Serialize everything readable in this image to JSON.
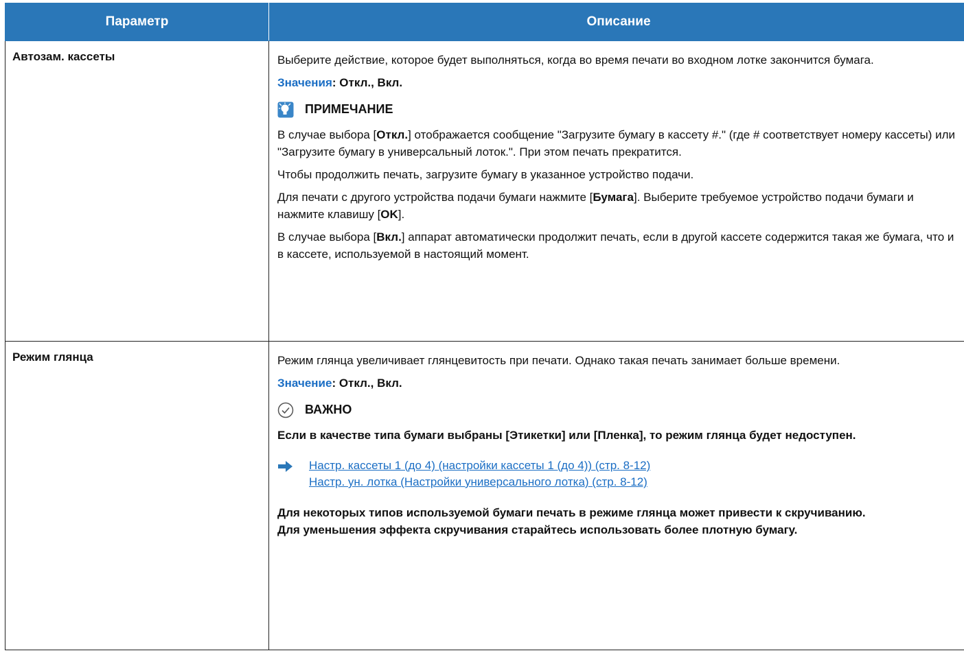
{
  "header": {
    "col_param": "Параметр",
    "col_desc": "Описание"
  },
  "rows": [
    {
      "param": "Автозам. кассеты",
      "intro": "Выберите действие, которое будет выполняться, когда во время печати во входном лотке закончится бумага.",
      "values_label": "Значения",
      "values_text": ": Откл., Вкл.",
      "note_title": "ПРИМЕЧАНИЕ",
      "p1_a": "В случае выбора [",
      "p1_b": "Откл.",
      "p1_c": "] отображается сообщение \"Загрузите бумагу в кассету #.\" (где # соответствует номеру кассеты) или \"Загрузите бумагу в универсальный лоток.\". При этом печать прекратится.",
      "p2": "Чтобы продолжить печать, загрузите бумагу в указанное устройство подачи.",
      "p3_a": "Для печати с другого устройства подачи бумаги нажмите [",
      "p3_b": "Бумага",
      "p3_c": "]. Выберите требуемое устройство подачи бумаги и нажмите клавишу [",
      "p3_d": "OK",
      "p3_e": "].",
      "p4_a": "В случае выбора [",
      "p4_b": "Вкл.",
      "p4_c": "] аппарат автоматически продолжит печать, если в другой кассете содержится такая же бумага, что и в кассете, используемой в настоящий момент."
    },
    {
      "param": "Режим глянца",
      "intro": "Режим глянца увеличивает глянцевитость при печати. Однако такая печать занимает больше времени.",
      "values_label": "Значение",
      "values_text": ": Откл., Вкл.",
      "note_title": "ВАЖНО",
      "important_text": "Если в качестве типа бумаги выбраны [Этикетки] или [Пленка], то режим глянца будет недоступен.",
      "link1": "Настр. кассеты 1 (до 4) (настройки кассеты 1 (до 4)) (стр. 8-12)",
      "link2": "Настр. ун. лотка (Настройки универсального лотка) (стр. 8-12)",
      "warn1": "Для некоторых типов используемой бумаги печать в режиме глянца может привести к скручиванию.",
      "warn2": "Для уменьшения эффекта скручивания старайтесь использовать более плотную бумагу."
    }
  ],
  "icons": {
    "note": "lightbulb-note-icon",
    "important": "checkmark-circle-icon",
    "link": "right-arrow-icon"
  },
  "colors": {
    "header_bg": "#2a77b8",
    "accent": "#1b6ec4"
  }
}
